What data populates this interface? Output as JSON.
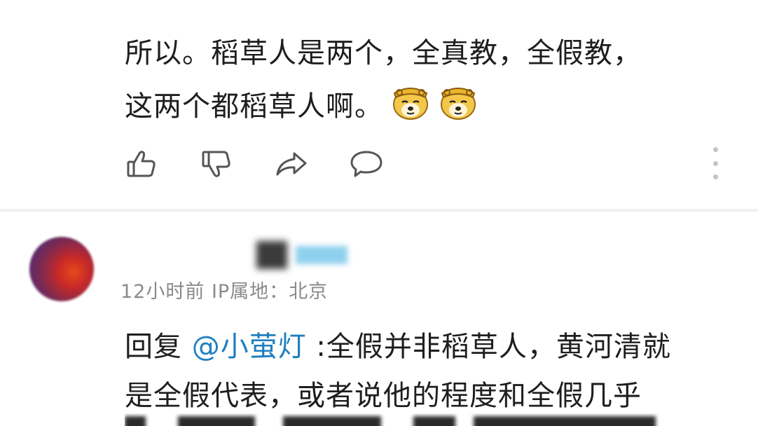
{
  "comment_1": {
    "text_line_1": "所以。稻草人是两个，全真教，全假教，",
    "text_line_2": "这两个都稻草人啊。",
    "emojis": [
      "doge-monkey-king-emoji",
      "doge-monkey-king-emoji"
    ],
    "actions": [
      "like-icon",
      "dislike-icon",
      "share-icon",
      "comment-icon"
    ],
    "more": "more-vertical-icon"
  },
  "comment_2": {
    "meta_prefix": "12小时前 IP属地：",
    "meta_location": "北京",
    "reply_label": "回复 ",
    "mention": "@小萤灯",
    "text_after_mention": " :全假并非稻草人，黄河清就",
    "text_line_2": "是全假代表，或者说他的程度和全假几乎"
  },
  "colors": {
    "text": "#1e1e1e",
    "mention": "#1f7fbf",
    "meta": "#8a8a8a",
    "icon": "#555555"
  }
}
